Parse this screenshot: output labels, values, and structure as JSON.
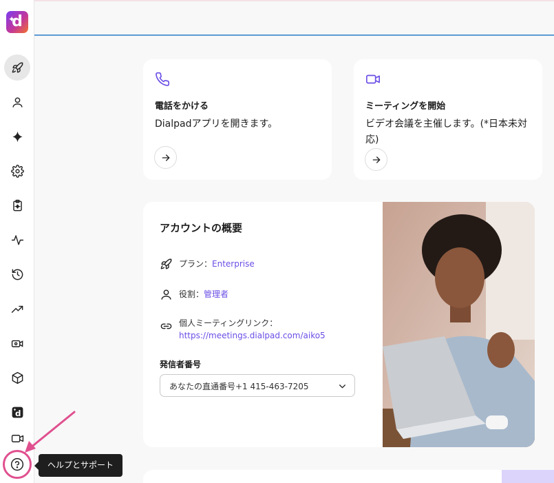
{
  "app": {
    "logo_letter": "d"
  },
  "tooltip": {
    "help": "ヘルプとサポート"
  },
  "cards": {
    "call": {
      "title": "電話をかける",
      "desc": "Dialpadアプリを開きます。"
    },
    "meeting": {
      "title": "ミーティングを開始",
      "desc": "ビデオ会議を主催します。(*日本未対応)"
    }
  },
  "overview": {
    "title": "アカウントの概要",
    "plan_label": "プラン：",
    "plan_value": "Enterprise",
    "role_label": "役割：",
    "role_value": "管理者",
    "meeting_link_label": "個人ミーティングリンク：",
    "meeting_link_value": "https://meetings.dialpad.com/aiko5",
    "caller_id_label": "発信者番号",
    "caller_id_value": "あなたの直通番号+1 415-463-7205"
  },
  "colors": {
    "accent": "#6b4ee6",
    "highlight": "#e0508f",
    "header_line": "#5d9ad3"
  }
}
